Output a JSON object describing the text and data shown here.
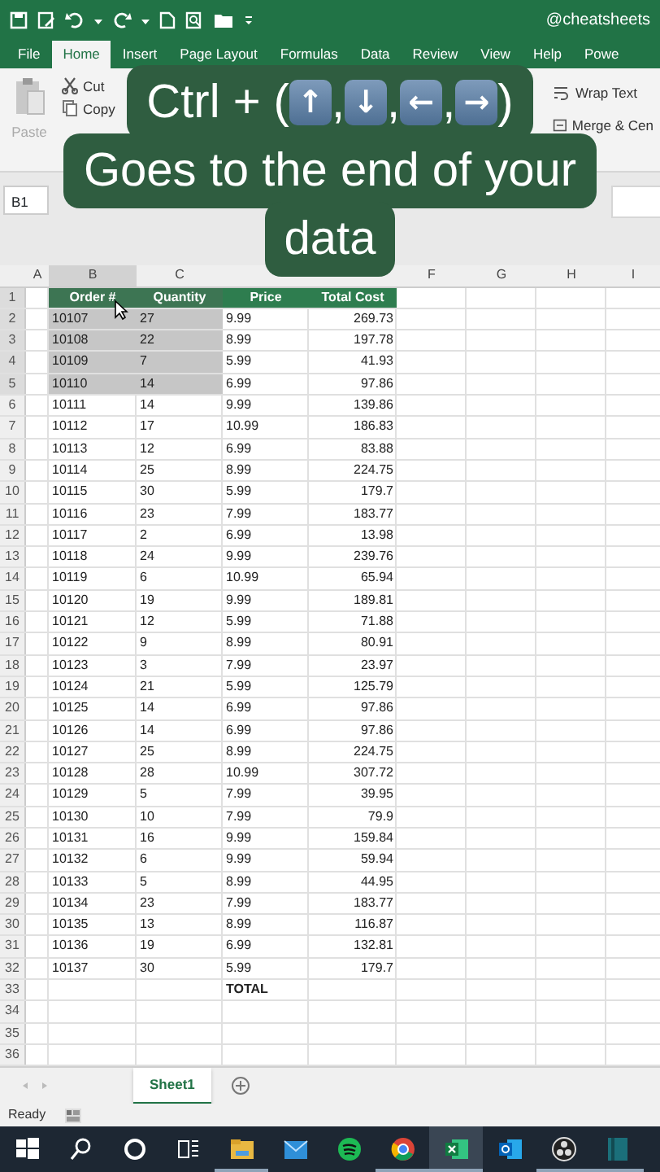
{
  "title_bar": {
    "title": "@cheatsheets"
  },
  "ribbon_tabs": [
    {
      "label": "File",
      "selected": false
    },
    {
      "label": "Home",
      "selected": true
    },
    {
      "label": "Insert",
      "selected": false
    },
    {
      "label": "Page Layout",
      "selected": false
    },
    {
      "label": "Formulas",
      "selected": false
    },
    {
      "label": "Data",
      "selected": false
    },
    {
      "label": "Review",
      "selected": false
    },
    {
      "label": "View",
      "selected": false
    },
    {
      "label": "Help",
      "selected": false
    },
    {
      "label": "Powe",
      "selected": false
    }
  ],
  "ribbon": {
    "paste": {
      "label": "Paste",
      "disabled": true
    },
    "clipboard": [
      "Cut",
      "Copy"
    ],
    "alignment": [
      "Wrap Text",
      "Merge & Cen"
    ]
  },
  "name_box": "B1",
  "caption": {
    "prefix": "Ctrl + (",
    "keys": [
      "↑",
      "↓",
      "←",
      "→"
    ],
    "separator": ",",
    "suffix": ")",
    "lines": [
      "Goes to the end of your",
      "data"
    ]
  },
  "columns": [
    {
      "letter": "A",
      "selected": false
    },
    {
      "letter": "B",
      "selected": true
    },
    {
      "letter": "C",
      "selected": false
    },
    {},
    {},
    {
      "letter": "F",
      "selected": false
    },
    {
      "letter": "G",
      "selected": false
    },
    {
      "letter": "H",
      "selected": false
    },
    {
      "letter": "I",
      "selected": false
    }
  ],
  "rows": [
    {
      "number": "1",
      "kind": "header",
      "selected": true,
      "cells": [
        "Order #",
        "Quantity",
        "Price",
        "Total Cost"
      ]
    },
    {
      "number": "2",
      "kind": "data",
      "selected": true,
      "cells": [
        "10107",
        "27",
        "9.99",
        "269.73"
      ]
    },
    {
      "number": "3",
      "kind": "data",
      "selected": true,
      "cells": [
        "10108",
        "22",
        "8.99",
        "197.78"
      ]
    },
    {
      "number": "4",
      "kind": "data",
      "selected": true,
      "cells": [
        "10109",
        "7",
        "5.99",
        "41.93"
      ]
    },
    {
      "number": "5",
      "kind": "data",
      "selected": true,
      "cells": [
        "10110",
        "14",
        "6.99",
        "97.86"
      ]
    },
    {
      "number": "6",
      "kind": "data",
      "selected": false,
      "cells": [
        "10111",
        "14",
        "9.99",
        "139.86"
      ]
    },
    {
      "number": "7",
      "kind": "data",
      "selected": false,
      "cells": [
        "10112",
        "17",
        "10.99",
        "186.83"
      ]
    },
    {
      "number": "8",
      "kind": "data",
      "selected": false,
      "cells": [
        "10113",
        "12",
        "6.99",
        "83.88"
      ]
    },
    {
      "number": "9",
      "kind": "data",
      "selected": false,
      "cells": [
        "10114",
        "25",
        "8.99",
        "224.75"
      ]
    },
    {
      "number": "10",
      "kind": "data",
      "selected": false,
      "cells": [
        "10115",
        "30",
        "5.99",
        "179.7"
      ]
    },
    {
      "number": "11",
      "kind": "data",
      "selected": false,
      "cells": [
        "10116",
        "23",
        "7.99",
        "183.77"
      ]
    },
    {
      "number": "12",
      "kind": "data",
      "selected": false,
      "cells": [
        "10117",
        "2",
        "6.99",
        "13.98"
      ]
    },
    {
      "number": "13",
      "kind": "data",
      "selected": false,
      "cells": [
        "10118",
        "24",
        "9.99",
        "239.76"
      ]
    },
    {
      "number": "14",
      "kind": "data",
      "selected": false,
      "cells": [
        "10119",
        "6",
        "10.99",
        "65.94"
      ]
    },
    {
      "number": "15",
      "kind": "data",
      "selected": false,
      "cells": [
        "10120",
        "19",
        "9.99",
        "189.81"
      ]
    },
    {
      "number": "16",
      "kind": "data",
      "selected": false,
      "cells": [
        "10121",
        "12",
        "5.99",
        "71.88"
      ]
    },
    {
      "number": "17",
      "kind": "data",
      "selected": false,
      "cells": [
        "10122",
        "9",
        "8.99",
        "80.91"
      ]
    },
    {
      "number": "18",
      "kind": "data",
      "selected": false,
      "cells": [
        "10123",
        "3",
        "7.99",
        "23.97"
      ]
    },
    {
      "number": "19",
      "kind": "data",
      "selected": false,
      "cells": [
        "10124",
        "21",
        "5.99",
        "125.79"
      ]
    },
    {
      "number": "20",
      "kind": "data",
      "selected": false,
      "cells": [
        "10125",
        "14",
        "6.99",
        "97.86"
      ]
    },
    {
      "number": "21",
      "kind": "data",
      "selected": false,
      "cells": [
        "10126",
        "14",
        "6.99",
        "97.86"
      ]
    },
    {
      "number": "22",
      "kind": "data",
      "selected": false,
      "cells": [
        "10127",
        "25",
        "8.99",
        "224.75"
      ]
    },
    {
      "number": "23",
      "kind": "data",
      "selected": false,
      "cells": [
        "10128",
        "28",
        "10.99",
        "307.72"
      ]
    },
    {
      "number": "24",
      "kind": "data",
      "selected": false,
      "cells": [
        "10129",
        "5",
        "7.99",
        "39.95"
      ]
    },
    {
      "number": "25",
      "kind": "data",
      "selected": false,
      "cells": [
        "10130",
        "10",
        "7.99",
        "79.9"
      ]
    },
    {
      "number": "26",
      "kind": "data",
      "selected": false,
      "cells": [
        "10131",
        "16",
        "9.99",
        "159.84"
      ]
    },
    {
      "number": "27",
      "kind": "data",
      "selected": false,
      "cells": [
        "10132",
        "6",
        "9.99",
        "59.94"
      ]
    },
    {
      "number": "28",
      "kind": "data",
      "selected": false,
      "cells": [
        "10133",
        "5",
        "8.99",
        "44.95"
      ]
    },
    {
      "number": "29",
      "kind": "data",
      "selected": false,
      "cells": [
        "10134",
        "23",
        "7.99",
        "183.77"
      ]
    },
    {
      "number": "30",
      "kind": "data",
      "selected": false,
      "cells": [
        "10135",
        "13",
        "8.99",
        "116.87"
      ]
    },
    {
      "number": "31",
      "kind": "data",
      "selected": false,
      "cells": [
        "10136",
        "19",
        "6.99",
        "132.81"
      ]
    },
    {
      "number": "32",
      "kind": "data",
      "selected": false,
      "cells": [
        "10137",
        "30",
        "5.99",
        "179.7"
      ]
    },
    {
      "number": "33",
      "kind": "total",
      "selected": false,
      "label": "TOTAL"
    },
    {
      "number": "34",
      "kind": "empty",
      "selected": false
    },
    {
      "number": "35",
      "kind": "empty",
      "selected": false
    },
    {
      "number": "36",
      "kind": "empty",
      "selected": false
    }
  ],
  "sheet_tabs": [
    {
      "label": "Sheet1",
      "selected": true
    }
  ],
  "status_bar": {
    "text": "Ready"
  },
  "taskbar": [
    {
      "kind": "start",
      "running": false,
      "active": false
    },
    {
      "kind": "search",
      "running": false,
      "active": false
    },
    {
      "kind": "cortana",
      "running": false,
      "active": false
    },
    {
      "kind": "taskview",
      "running": false,
      "active": false
    },
    {
      "kind": "explorer",
      "running": true,
      "active": false
    },
    {
      "kind": "mail",
      "running": false,
      "active": false
    },
    {
      "kind": "spotify",
      "running": false,
      "active": false
    },
    {
      "kind": "chrome",
      "running": true,
      "active": false
    },
    {
      "kind": "excel",
      "running": true,
      "active": true
    },
    {
      "kind": "outlook",
      "running": false,
      "active": false
    },
    {
      "kind": "obs",
      "running": true,
      "active": false
    },
    {
      "kind": "app",
      "running": true,
      "active": false
    }
  ]
}
